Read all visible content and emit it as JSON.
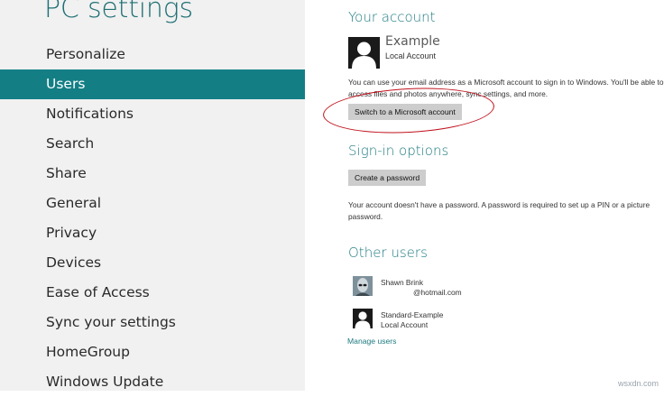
{
  "app_title": "PC settings",
  "nav": {
    "items": [
      {
        "label": "Personalize"
      },
      {
        "label": "Users",
        "selected": true
      },
      {
        "label": "Notifications"
      },
      {
        "label": "Search"
      },
      {
        "label": "Share"
      },
      {
        "label": "General"
      },
      {
        "label": "Privacy"
      },
      {
        "label": "Devices"
      },
      {
        "label": "Ease of Access"
      },
      {
        "label": "Sync your settings"
      },
      {
        "label": "HomeGroup"
      },
      {
        "label": "Windows Update"
      }
    ]
  },
  "your_account": {
    "heading": "Your account",
    "name": "Example",
    "type": "Local Account",
    "description": "You can use your email address as a Microsoft account to sign in to Windows. You'll be able to access files and photos anywhere, sync settings, and more.",
    "switch_button": "Switch to a Microsoft account"
  },
  "signin_options": {
    "heading": "Sign-in options",
    "create_password_button": "Create a password",
    "description": "Your account doesn't have a password. A password is required to set up a PIN or a picture password."
  },
  "other_users": {
    "heading": "Other users",
    "users": [
      {
        "name": "Shawn Brink",
        "detail": "@hotmail.com",
        "avatar": "alien-avatar"
      },
      {
        "name": "Standard-Example",
        "detail": "Local Account",
        "avatar": "person-silhouette-icon"
      }
    ],
    "manage_link": "Manage users"
  },
  "watermark": "wsxdn.com",
  "colors": {
    "accent": "#137f85",
    "heading": "#1e7a80",
    "left_pane_bg": "#f1f1f1",
    "button_bg": "#cdcdcd",
    "highlight_ellipse": "#c0111b"
  }
}
